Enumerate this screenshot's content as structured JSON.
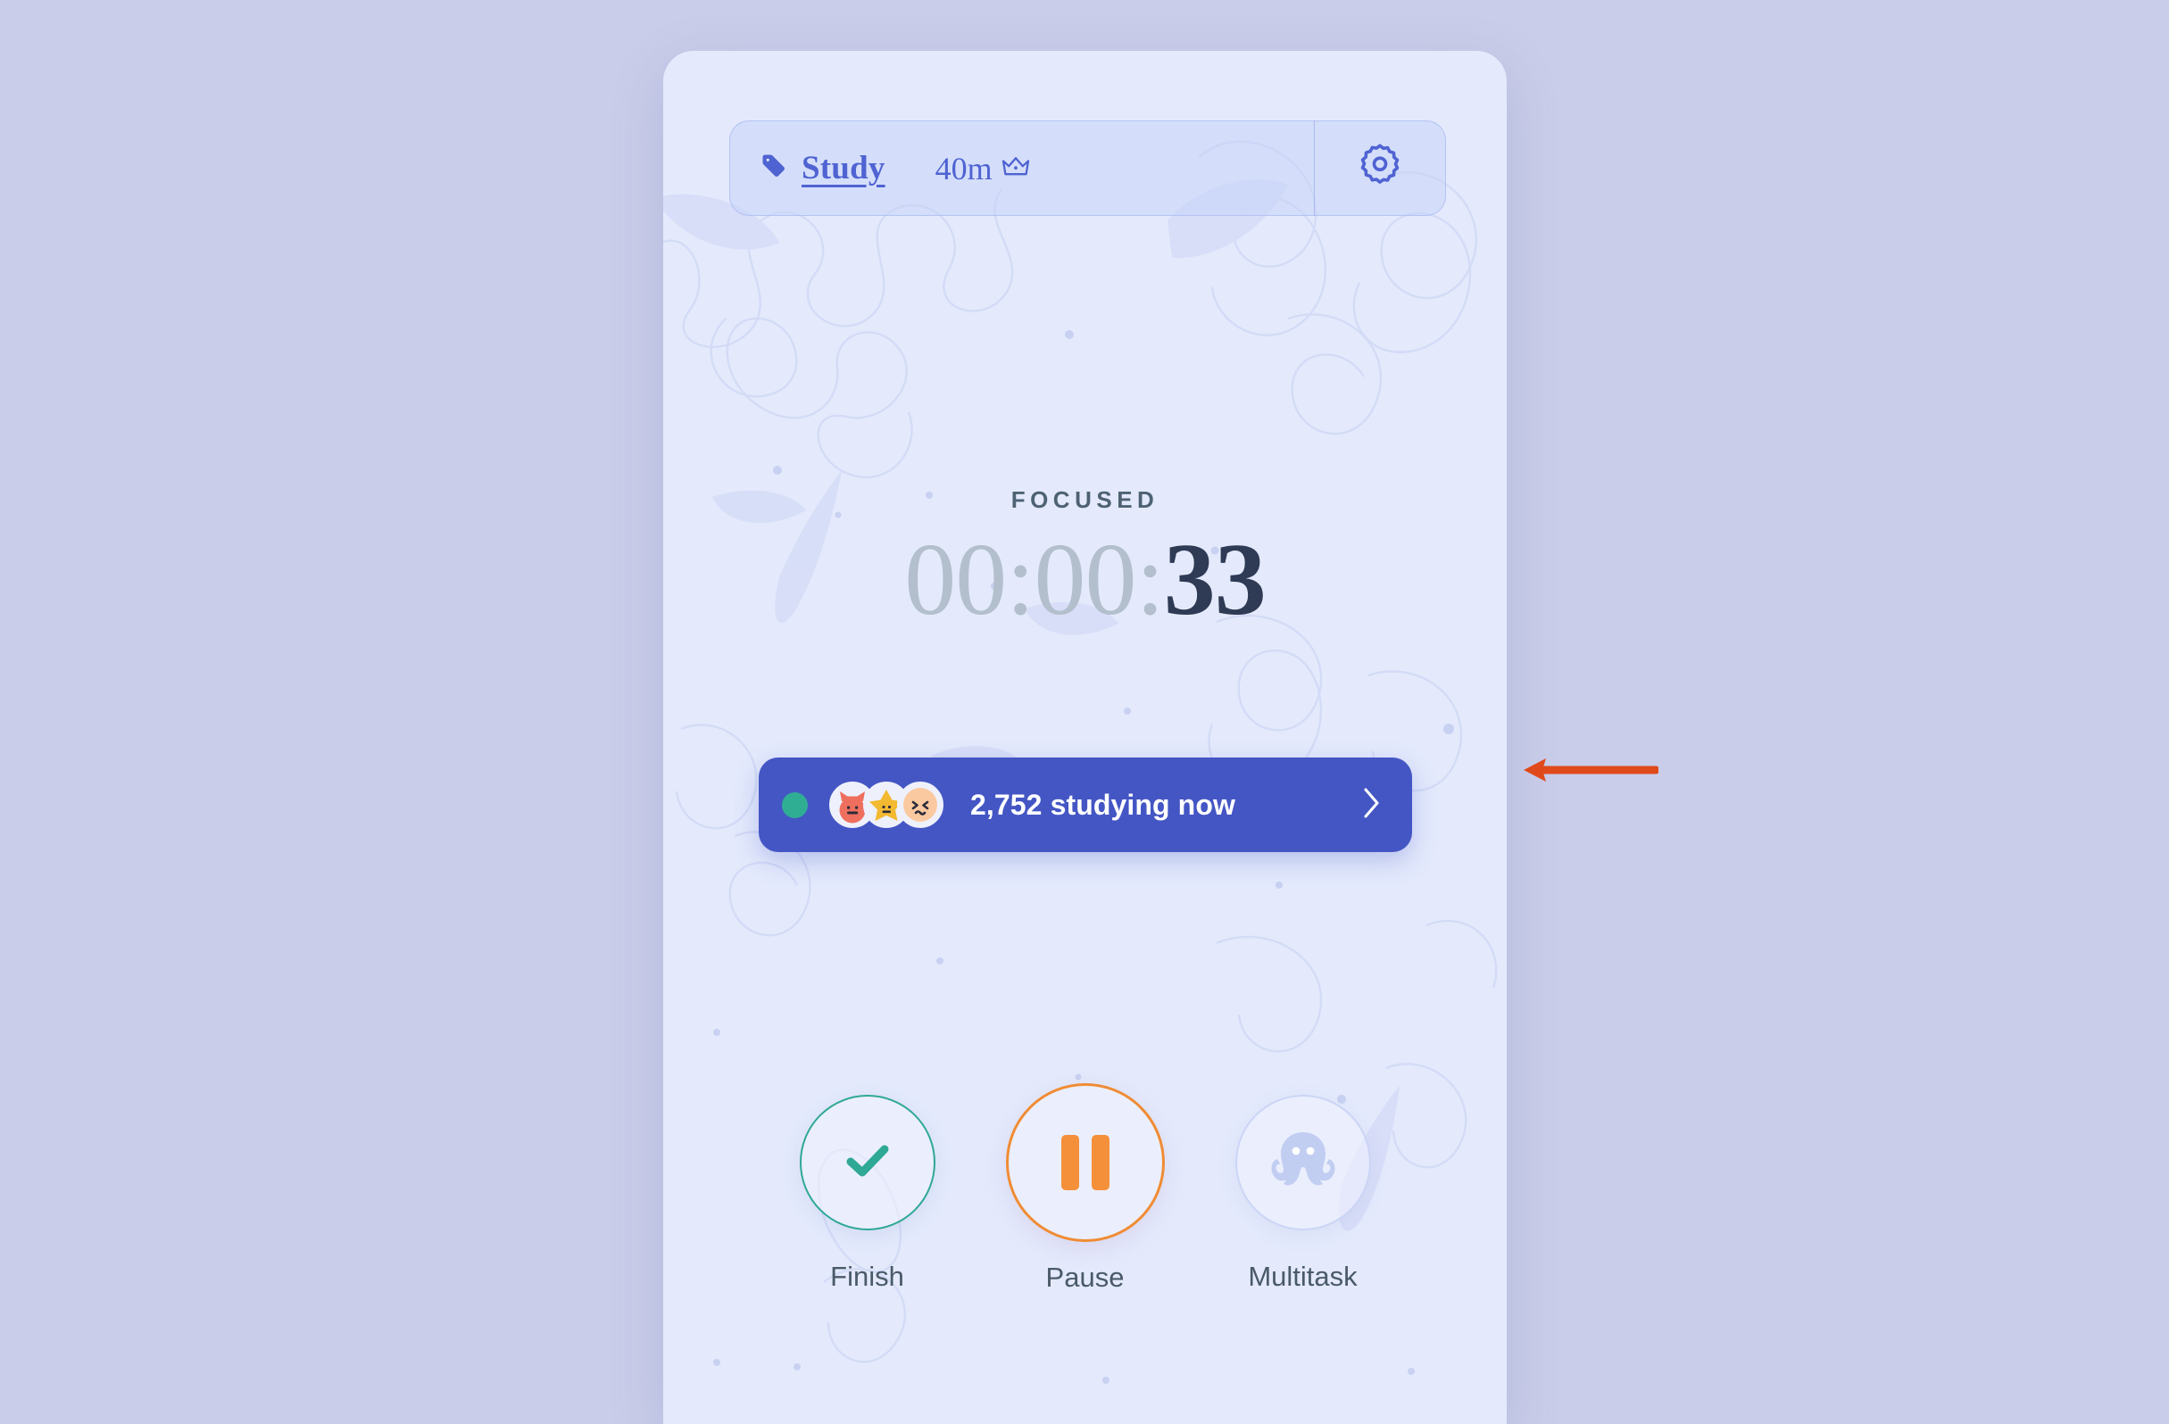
{
  "theme": {
    "page_background": "#c9cde9",
    "card_background": "#e4eafc",
    "accent_blue": "#4f63d2",
    "banner_blue": "#4456c4",
    "accent_green": "#2fa896",
    "accent_orange": "#f5903a",
    "live_dot_green": "#2fae94",
    "annotation_red": "#e04a1a",
    "timer_dim": "#b3bfcd",
    "timer_active": "#2f3a54"
  },
  "tag_bar": {
    "tag_icon": "tag-icon",
    "label": "Study",
    "duration": "40m",
    "crown_icon": "crown-icon",
    "settings_icon": "gear-icon"
  },
  "timer": {
    "status_label": "FOCUSED",
    "hours": "00",
    "minutes": "00",
    "seconds": "33",
    "separator": ":",
    "full_value": "00:00:33"
  },
  "live_banner": {
    "status_dot": "live-status-dot",
    "avatars": [
      {
        "name": "avatar-cat",
        "color": "#ef6f5e"
      },
      {
        "name": "avatar-star",
        "color": "#f2b931"
      },
      {
        "name": "avatar-peach",
        "color": "#fbc9a0"
      }
    ],
    "text": "2,752 studying now",
    "count": "2,752",
    "chevron_icon": "chevron-right-icon"
  },
  "actions": [
    {
      "name": "finish",
      "label": "Finish",
      "icon": "check-icon",
      "color": "#2fa896"
    },
    {
      "name": "pause",
      "label": "Pause",
      "icon": "pause-icon",
      "color": "#f5903a"
    },
    {
      "name": "multitask",
      "label": "Multitask",
      "icon": "octopus-icon",
      "color": "#c2cdf2"
    }
  ],
  "annotation": {
    "arrow_icon": "left-arrow-annotation",
    "color": "#e04a1a"
  }
}
